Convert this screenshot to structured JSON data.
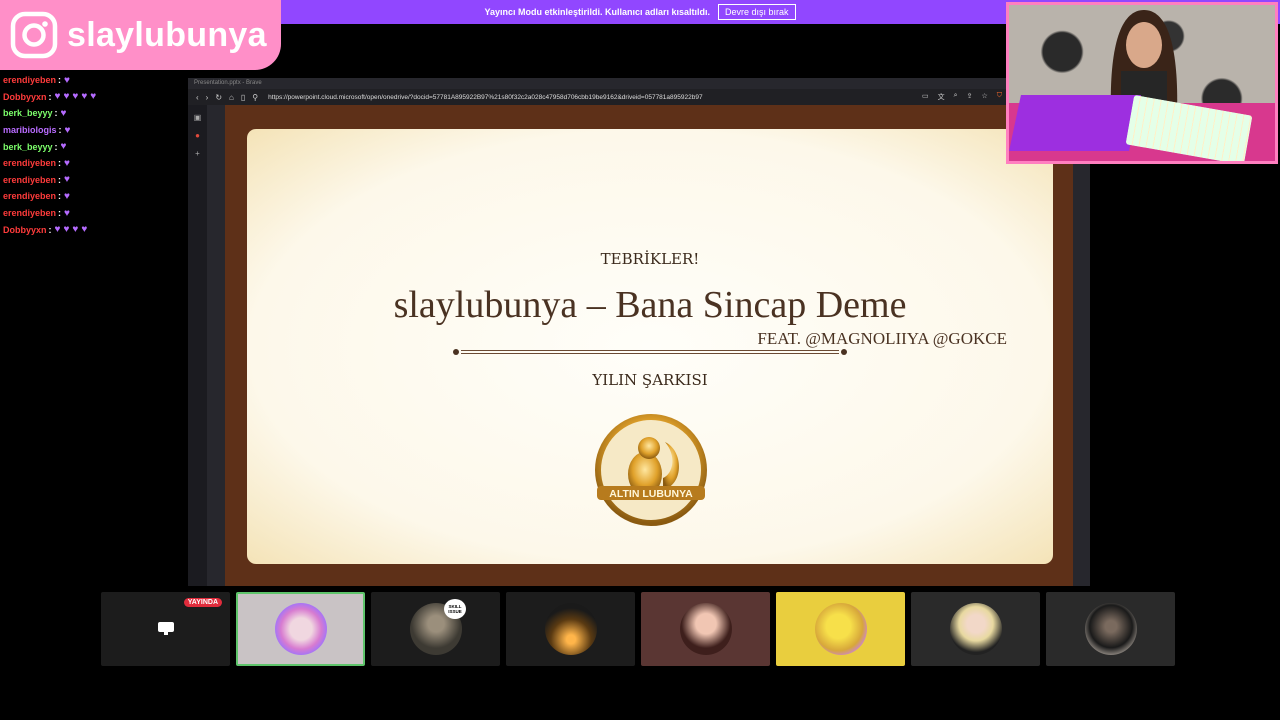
{
  "notice": {
    "text": "Yayıncı Modu etkinleştirildi. Kullanıcı adları kısaltıldı.",
    "button": "Devre dışı bırak"
  },
  "instagram": {
    "handle": "slaylubunya",
    "icon": "instagram-icon"
  },
  "chat": [
    {
      "user": "erendiyeben",
      "color": "#ff3b3b",
      "emotes": 1
    },
    {
      "user": "Dobbyyxn",
      "color": "#ff3b3b",
      "emotes": 5
    },
    {
      "user": "berk_beyyy",
      "color": "#7cff6b",
      "emotes": 1
    },
    {
      "user": "maribiologis",
      "color": "#b96cff",
      "emotes": 1
    },
    {
      "user": "berk_beyyy",
      "color": "#7cff6b",
      "emotes": 1
    },
    {
      "user": "erendiyeben",
      "color": "#ff3b3b",
      "emotes": 1
    },
    {
      "user": "erendiyeben",
      "color": "#ff3b3b",
      "emotes": 1
    },
    {
      "user": "erendiyeben",
      "color": "#ff3b3b",
      "emotes": 1
    },
    {
      "user": "erendiyeben",
      "color": "#ff3b3b",
      "emotes": 1
    },
    {
      "user": "Dobbyyxn",
      "color": "#ff3b3b",
      "emotes": 4
    }
  ],
  "browser": {
    "window_title": "Presentation.pptx - Brave",
    "url": "https://powerpoint.cloud.microsoft/open/onedrive/?docid=57781A895922B97%21s80f32c2a028c47958d706cbb19be9162&driveid=057781a895922b97"
  },
  "slide": {
    "congrats": "TEBRİKLER!",
    "title": "slaylubunya – Bana Sincap Deme",
    "feat": "FEAT. @MAGNOLIIYA @GOKCE",
    "category": "YILIN ŞARKISI",
    "badge_text": "ALTIN LUBUNYA"
  },
  "participants": {
    "live_label": "YAYINDA",
    "skill_label": "SKILL ISSUE"
  },
  "colors": {
    "twitch_purple": "#9147ff",
    "instagram_pink": "#ff8fc8",
    "active_border": "#5ec46b"
  }
}
